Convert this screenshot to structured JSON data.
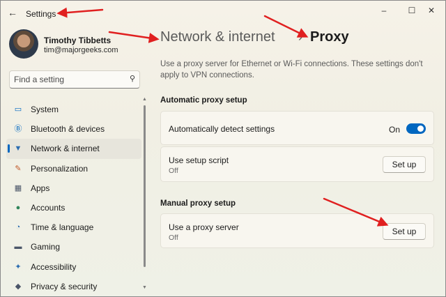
{
  "window": {
    "title": "Settings",
    "back_icon": "back-arrow-icon"
  },
  "user": {
    "name": "Timothy Tibbetts",
    "email": "tim@majorgeeks.com"
  },
  "search": {
    "placeholder": "Find a setting"
  },
  "sidebar": {
    "items": [
      {
        "label": "System",
        "icon": "system-icon",
        "color": "#0067c0",
        "active": false
      },
      {
        "label": "Bluetooth & devices",
        "icon": "bluetooth-icon",
        "color": "#0067c0",
        "active": false
      },
      {
        "label": "Network & internet",
        "icon": "wifi-icon",
        "color": "#2b6cb0",
        "active": true
      },
      {
        "label": "Personalization",
        "icon": "brush-icon",
        "color": "#c05a2a",
        "active": false
      },
      {
        "label": "Apps",
        "icon": "apps-icon",
        "color": "#4a5568",
        "active": false
      },
      {
        "label": "Accounts",
        "icon": "accounts-icon",
        "color": "#2f855a",
        "active": false
      },
      {
        "label": "Time & language",
        "icon": "globe-clock-icon",
        "color": "#2b6cb0",
        "active": false
      },
      {
        "label": "Gaming",
        "icon": "gamepad-icon",
        "color": "#4a5568",
        "active": false
      },
      {
        "label": "Accessibility",
        "icon": "accessibility-icon",
        "color": "#2b6cb0",
        "active": false
      },
      {
        "label": "Privacy & security",
        "icon": "shield-icon",
        "color": "#4a5568",
        "active": false
      }
    ]
  },
  "breadcrumb": {
    "parent": "Network & internet",
    "separator": "›",
    "current": "Proxy"
  },
  "intro": "Use a proxy server for Ethernet or Wi-Fi connections. These settings don't apply to VPN connections.",
  "automatic": {
    "title": "Automatic proxy setup",
    "detect": {
      "label": "Automatically detect settings",
      "state": "On"
    },
    "script": {
      "label": "Use setup script",
      "status": "Off",
      "button": "Set up"
    }
  },
  "manual": {
    "title": "Manual proxy setup",
    "proxy": {
      "label": "Use a proxy server",
      "status": "Off",
      "button": "Set up"
    }
  },
  "colors": {
    "accent": "#0067c0",
    "annotation_arrow": "#e02020"
  }
}
